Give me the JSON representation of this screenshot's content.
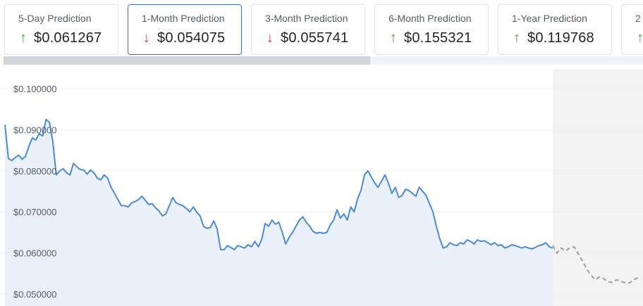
{
  "cards": [
    {
      "title": "5-Day Prediction",
      "value": "$0.061267",
      "direction": "up",
      "active": false
    },
    {
      "title": "1-Month Prediction",
      "value": "$0.054075",
      "direction": "down",
      "active": true
    },
    {
      "title": "3-Month Prediction",
      "value": "$0.055741",
      "direction": "down",
      "active": false
    },
    {
      "title": "6-Month Prediction",
      "value": "$0.155321",
      "direction": "up",
      "active": false
    },
    {
      "title": "1-Year Prediction",
      "value": "$0.119768",
      "direction": "up",
      "active": false
    },
    {
      "title": "2",
      "value": "$",
      "direction": "up",
      "active": false
    }
  ],
  "colors": {
    "history_line": "#4a8ad6",
    "history_fill": "#eaf1fb",
    "forecast_line": "#a0a0a0",
    "forecast_bg": "#f3f3f3",
    "up_arrow": "#3fae3f",
    "down_arrow": "#e0303e",
    "grid": "#eef0f3"
  },
  "chart_data": {
    "type": "line",
    "ylim": [
      0.05,
      0.1
    ],
    "y_ticks": [
      0.1,
      0.09,
      0.08,
      0.07,
      0.06,
      0.05
    ],
    "y_tick_labels": [
      "$0.100000",
      "$0.090000",
      "$0.080000",
      "$0.070000",
      "$0.060000",
      "$0.050000"
    ],
    "grid": true,
    "series": [
      {
        "kind": "history",
        "values": [
          0.0912,
          0.083,
          0.0825,
          0.0832,
          0.0838,
          0.0828,
          0.0835,
          0.086,
          0.088,
          0.0875,
          0.089,
          0.0885,
          0.0925,
          0.0918,
          0.087,
          0.079,
          0.08,
          0.0805,
          0.0795,
          0.079,
          0.0818,
          0.081,
          0.0803,
          0.0802,
          0.0792,
          0.0802,
          0.0795,
          0.0782,
          0.0778,
          0.079,
          0.0782,
          0.076,
          0.0745,
          0.073,
          0.0715,
          0.0715,
          0.0712,
          0.0722,
          0.0725,
          0.073,
          0.0738,
          0.0728,
          0.0718,
          0.072,
          0.071,
          0.0702,
          0.069,
          0.0695,
          0.0715,
          0.0735,
          0.0722,
          0.0718,
          0.0715,
          0.0708,
          0.07,
          0.0712,
          0.07,
          0.069,
          0.0665,
          0.066,
          0.0662,
          0.0678,
          0.0658,
          0.0608,
          0.0608,
          0.0618,
          0.0613,
          0.0608,
          0.0618,
          0.0615,
          0.0612,
          0.062,
          0.0615,
          0.0628,
          0.0615,
          0.0633,
          0.0672,
          0.0665,
          0.068,
          0.067,
          0.0675,
          0.065,
          0.0622,
          0.0638,
          0.065,
          0.0665,
          0.068,
          0.0688,
          0.0675,
          0.0665,
          0.0652,
          0.0648,
          0.065,
          0.0648,
          0.065,
          0.0668,
          0.068,
          0.0705,
          0.0685,
          0.0695,
          0.068,
          0.0712,
          0.07,
          0.0732,
          0.0752,
          0.079,
          0.08,
          0.0785,
          0.077,
          0.076,
          0.0775,
          0.079,
          0.077,
          0.0745,
          0.076,
          0.0735,
          0.074,
          0.0755,
          0.0752,
          0.0745,
          0.0738,
          0.076,
          0.075,
          0.074,
          0.072,
          0.07,
          0.0665,
          0.0635,
          0.0612,
          0.0615,
          0.0625,
          0.062,
          0.0618,
          0.0625,
          0.0622,
          0.0632,
          0.0628,
          0.0622,
          0.0632,
          0.0628,
          0.063,
          0.0625,
          0.062,
          0.0625,
          0.0618,
          0.062,
          0.0612,
          0.0615,
          0.062,
          0.0618,
          0.0615,
          0.0612,
          0.0615,
          0.0612,
          0.061,
          0.0614,
          0.0618,
          0.062,
          0.0625,
          0.0615,
          0.0612
        ]
      },
      {
        "kind": "forecast",
        "values": [
          0.0618,
          0.06,
          0.0612,
          0.0605,
          0.0612,
          0.0615,
          0.0598,
          0.058,
          0.056,
          0.0545,
          0.0535,
          0.0542,
          0.0537,
          0.053,
          0.0528,
          0.0535,
          0.053,
          0.0528,
          0.0527,
          0.0535,
          0.054
        ]
      }
    ]
  }
}
